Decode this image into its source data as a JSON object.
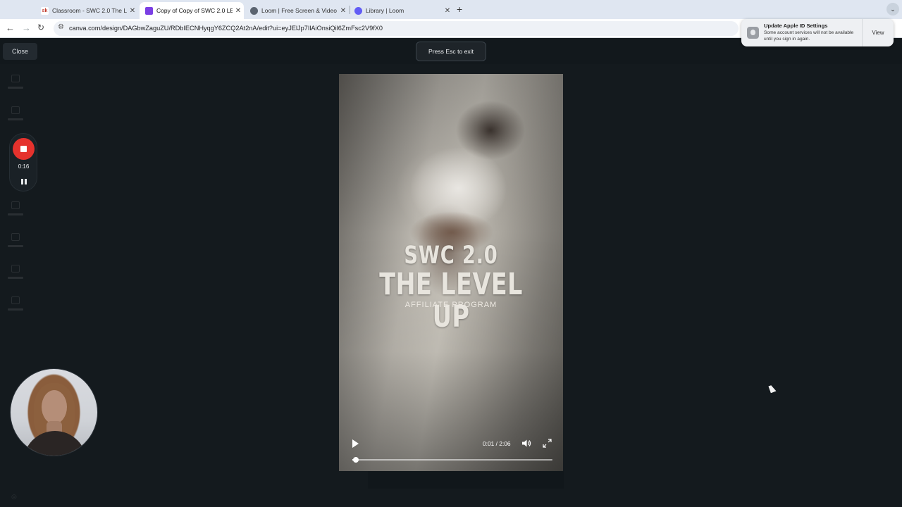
{
  "browser": {
    "tabs": [
      {
        "title": "Classroom - SWC 2.0 The Lev",
        "favicon": "sk",
        "active": false
      },
      {
        "title": "Copy of Copy of SWC 2.0 LE",
        "favicon": "canva-video",
        "active": true
      },
      {
        "title": "Loom | Free Screen & Video R",
        "favicon": "globe",
        "active": false
      },
      {
        "title": "Library | Loom",
        "favicon": "loom",
        "active": false
      }
    ],
    "url": "canva.com/design/DAGbwZaguZU/RDbIECNHyqgY6ZCQ2At2nA/edit?ui=eyJElJp7IlAiOnsiQil6ZmFsc2V9fX0"
  },
  "editor": {
    "close_label": "Close",
    "esc_hint": "Press Esc to exit"
  },
  "recording": {
    "elapsed": "0:16"
  },
  "video": {
    "title_line1": "SWC 2.0",
    "title_line2": "THE LEVEL UP",
    "subtitle": "AFFILIATE PROGRAM",
    "time": "0:01 / 2:06",
    "progress": 0.01
  },
  "notification": {
    "title": "Update Apple ID Settings",
    "body": "Some account services will not be available until you sign in again.",
    "action": "View"
  },
  "colors": {
    "record_red": "#e5322d",
    "background": "#141a1e"
  }
}
